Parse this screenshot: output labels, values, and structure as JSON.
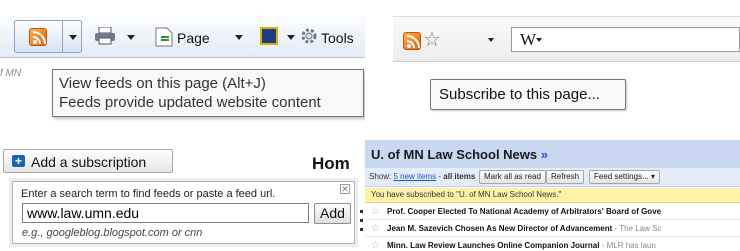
{
  "ie_toolbar": {
    "feed_icon": "rss-feed-icon",
    "print_icon": "printer-icon",
    "page_icon": "page-icon",
    "safety_icon": "safety-icon",
    "gear_icon": "gear-icon",
    "page_label": "Page",
    "tools_label": "Tools",
    "left_fragment": "f MN",
    "tooltip_line1": "View feeds on this page (Alt+J)",
    "tooltip_line2": "Feeds provide updated website content"
  },
  "firefox_bar": {
    "feed_icon": "rss-feed-icon",
    "star_icon": "bookmark-star-icon",
    "search_engine_logo": "W",
    "tooltip": "Subscribe to this page..."
  },
  "reader_add": {
    "add_button_label": "Add a subscription",
    "home_label": "Hom",
    "hint": "Enter a search term to find feeds or paste a feed url.",
    "input_value": "www.law.umn.edu",
    "add_label": "Add",
    "example": "e.g., googleblog.blogspot.com or cnn"
  },
  "reader_feed": {
    "title": "U. of MN Law School News",
    "title_arrow": "»",
    "show_label": "Show:",
    "show_new": "5 new items",
    "show_sep": " - ",
    "show_all": "all items",
    "mark_all_read": "Mark all as read",
    "refresh": "Refresh",
    "feed_settings": "Feed settings...",
    "subscribed_notice": "You have subscribed to \"U. of MN Law School News.\"",
    "items": [
      {
        "title": "Prof. Cooper Elected To National Academy of Arbitrators' Board of Gove",
        "snippet": ""
      },
      {
        "title": "Jean M. Sazevich Chosen As New Director of Advancement",
        "snippet": " - The Law Sc"
      },
      {
        "title": "Minn. Law Review Launches Online Companion Journal",
        "snippet": " - MLR has laun"
      }
    ]
  },
  "colors": {
    "reader_header": "#c9d7f1",
    "reader_notice": "#fff2a8",
    "rss_orange": "#e8610f",
    "link_blue": "#2255cc"
  }
}
